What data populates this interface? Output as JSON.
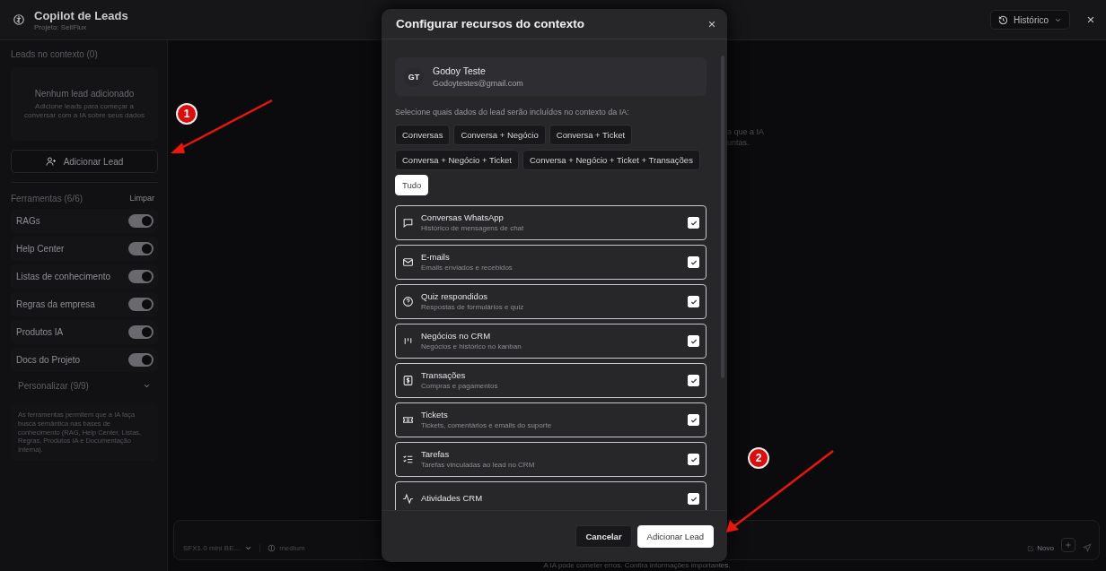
{
  "header": {
    "title": "Copilot de Leads",
    "subtitle": "Projeto: SellFlux",
    "history_button": "Histórico"
  },
  "sidebar": {
    "leads_heading": "Leads no contexto (0)",
    "empty_title": "Nenhum lead adicionado",
    "empty_text": "Adicione leads para começar a conversar com a IA sobre seus dados",
    "add_button": "Adicionar Lead",
    "tools_heading": "Ferramentas (6/6)",
    "clear_button": "Limpar",
    "tools": [
      {
        "label": "RAGs",
        "on": true
      },
      {
        "label": "Help Center",
        "on": true
      },
      {
        "label": "Listas de conhecimento",
        "on": true
      },
      {
        "label": "Regras da empresa",
        "on": true
      },
      {
        "label": "Produtos IA",
        "on": true
      },
      {
        "label": "Docs do Projeto",
        "on": true
      }
    ],
    "customize": {
      "label": "Personalizar (9/9)",
      "expanded": false
    },
    "info": "As ferramentas permitem que a IA faça busca semântica nas bases de conhecimento (RAG, Help Center, Listas, Regras, Produtos IA e Documentação Interna)."
  },
  "main": {
    "hint_lines": [
      "a que a IA",
      "untas."
    ]
  },
  "composer": {
    "model": "SFX1.0 mini BE...",
    "effort": "medium",
    "new_button": "Novo",
    "disclaimer": "A IA pode cometer erros. Confira informações importantes."
  },
  "modal": {
    "title": "Configurar recursos do contexto",
    "lead": {
      "initials": "GT",
      "name": "Godoy Teste",
      "email": "Godoytestes@gmail.com"
    },
    "prompt": "Selecione quais dados do lead serão incluídos no contexto da IA:",
    "presets": [
      {
        "label": "Conversas",
        "selected": false
      },
      {
        "label": "Conversa + Negócio",
        "selected": false
      },
      {
        "label": "Conversa + Ticket",
        "selected": false
      },
      {
        "label": "Conversa + Negócio + Ticket",
        "selected": false
      },
      {
        "label": "Conversa + Negócio + Ticket + Transações",
        "selected": false
      },
      {
        "label": "Tudo",
        "selected": true
      }
    ],
    "resources": [
      {
        "kind": "chat",
        "title": "Conversas WhatsApp",
        "subtitle": "Histórico de mensagens de chat",
        "checked": true
      },
      {
        "kind": "mail",
        "title": "E-mails",
        "subtitle": "Emails enviados e recebidos",
        "checked": true
      },
      {
        "kind": "question",
        "title": "Quiz respondidos",
        "subtitle": "Respostas de formulários e quiz",
        "checked": true
      },
      {
        "kind": "kanban",
        "title": "Negócios no CRM",
        "subtitle": "Negócios e histórico no kanban",
        "checked": true
      },
      {
        "kind": "money",
        "title": "Transações",
        "subtitle": "Compras e pagamentos",
        "checked": true
      },
      {
        "kind": "ticket",
        "title": "Tickets",
        "subtitle": "Tickets, comentários e emails do suporte",
        "checked": true
      },
      {
        "kind": "tasks",
        "title": "Tarefas",
        "subtitle": "Tarefas vinculadas ao lead no CRM",
        "checked": true
      },
      {
        "kind": "activity",
        "title": "Atividades CRM",
        "checked": true
      }
    ],
    "cancel_button": "Cancelar",
    "confirm_button": "Adicionar Lead"
  },
  "annotations": [
    {
      "number": "1"
    },
    {
      "number": "2"
    }
  ]
}
